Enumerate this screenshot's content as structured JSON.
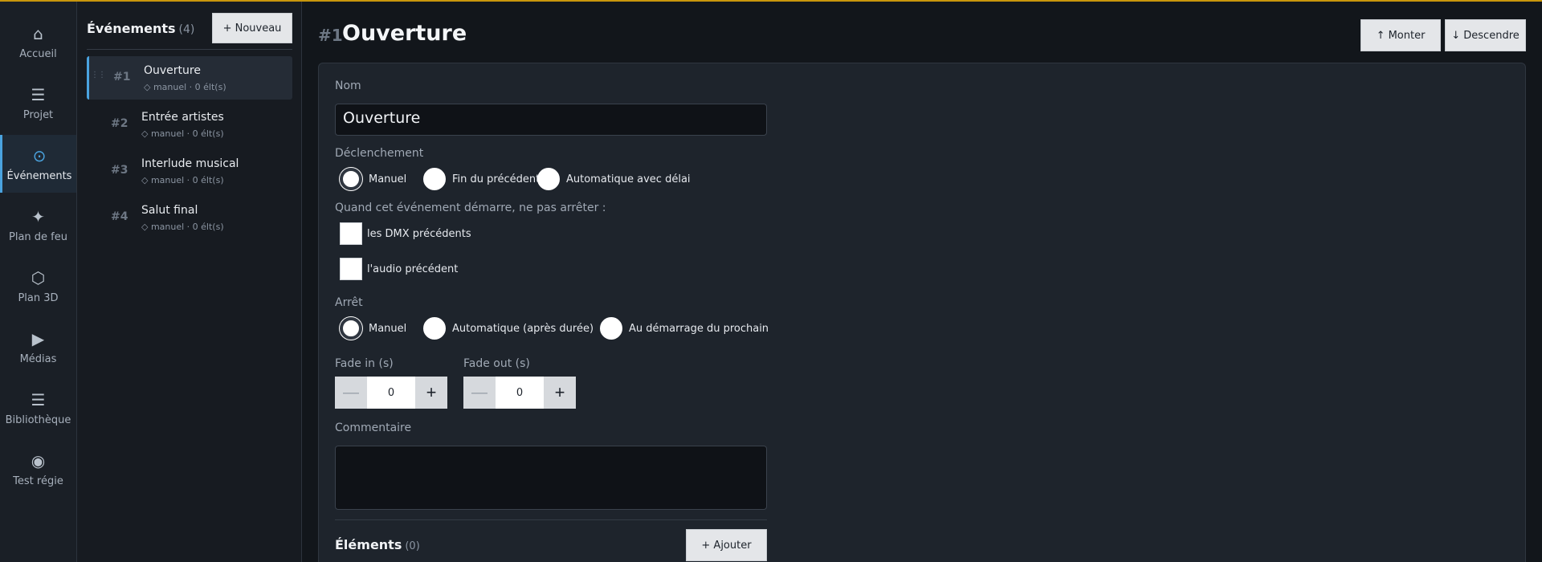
{
  "nav": {
    "items": [
      {
        "label": "Accueil",
        "icon": "⌂"
      },
      {
        "label": "Projet",
        "icon": "☰"
      },
      {
        "label": "Événements",
        "icon": "⊙"
      },
      {
        "label": "Plan de feu",
        "icon": "✦"
      },
      {
        "label": "Plan 3D",
        "icon": "⬡"
      },
      {
        "label": "Médias",
        "icon": "▶"
      },
      {
        "label": "Bibliothèque",
        "icon": "☰"
      },
      {
        "label": "Test régie",
        "icon": "◉"
      }
    ],
    "active_index": 2
  },
  "events_panel": {
    "title": "Événements",
    "count": "(4)",
    "new_button": "+ Nouveau",
    "drag_handle": "⋮⋮",
    "items": [
      {
        "num": "#1",
        "name": "Ouverture",
        "meta": "◇ manuel · 0 élt(s)"
      },
      {
        "num": "#2",
        "name": "Entrée artistes",
        "meta": "◇ manuel · 0 élt(s)"
      },
      {
        "num": "#3",
        "name": "Interlude musical",
        "meta": "◇ manuel · 0 élt(s)"
      },
      {
        "num": "#4",
        "name": "Salut final",
        "meta": "◇ manuel · 0 élt(s)"
      }
    ]
  },
  "editor": {
    "num": "#1",
    "title": "Ouverture",
    "up_button": "↑ Monter",
    "down_button": "↓ Descendre",
    "name_label": "Nom",
    "name_value": "Ouverture",
    "trigger_label": "Déclenchement",
    "trigger_options": [
      "Manuel",
      "Fin du précédent",
      "Automatique avec délai"
    ],
    "trigger_selected": "Manuel",
    "no_stop_label": "Quand cet événement démarre, ne pas arrêter :",
    "no_stop_dmx": "les DMX précédents",
    "no_stop_audio": "l'audio précédent",
    "stop_label": "Arrêt",
    "stop_options": [
      "Manuel",
      "Automatique (après durée)",
      "Au démarrage du prochain"
    ],
    "stop_selected": "Manuel",
    "fade_in_label": "Fade in (s)",
    "fade_in_value": "0",
    "fade_out_label": "Fade out (s)",
    "fade_out_value": "0",
    "minus_symbol": "—",
    "plus_symbol": "+",
    "comment_label": "Commentaire",
    "elements_title": "Éléments",
    "elements_count": "(0)",
    "add_button": "+ Ajouter"
  },
  "colors": {
    "accent": "#4aa3df",
    "top_line": "#c8960c"
  }
}
